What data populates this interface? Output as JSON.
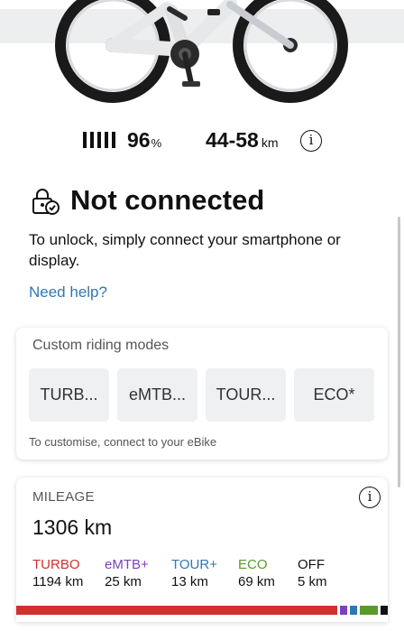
{
  "stats": {
    "battery_value": "96",
    "battery_unit": "%",
    "battery_level_percent": 96,
    "range_value": "44-58",
    "range_unit": "km",
    "info_symbol": "i"
  },
  "connection": {
    "status_title": "Not connected",
    "description": "To unlock, simply connect your smartphone or display.",
    "help_link": "Need help?",
    "icon": "lock-check-icon"
  },
  "riding_modes": {
    "title": "Custom riding modes",
    "modes": [
      "TURB...",
      "eMTB...",
      "TOUR...",
      "ECO*"
    ],
    "hint": "To customise, connect to your eBike"
  },
  "mileage": {
    "title": "MILEAGE",
    "total": "1306 km",
    "info_symbol": "i",
    "breakdown": [
      {
        "name": "TURBO",
        "value": "1194 km",
        "km": 1194,
        "color": "#d0312d"
      },
      {
        "name": "eMTB+",
        "value": "25 km",
        "km": 25,
        "color": "#7b3fbf"
      },
      {
        "name": "TOUR+",
        "value": "13 km",
        "km": 13,
        "color": "#2f78b7"
      },
      {
        "name": "ECO",
        "value": "69 km",
        "km": 69,
        "color": "#5a9a2a"
      },
      {
        "name": "OFF",
        "value": "5 km",
        "km": 5,
        "color": "#111111"
      }
    ]
  },
  "colors": {
    "accent_link": "#2f78b7",
    "card_bg": "#ffffff",
    "mode_button_bg": "#eef0f2"
  }
}
